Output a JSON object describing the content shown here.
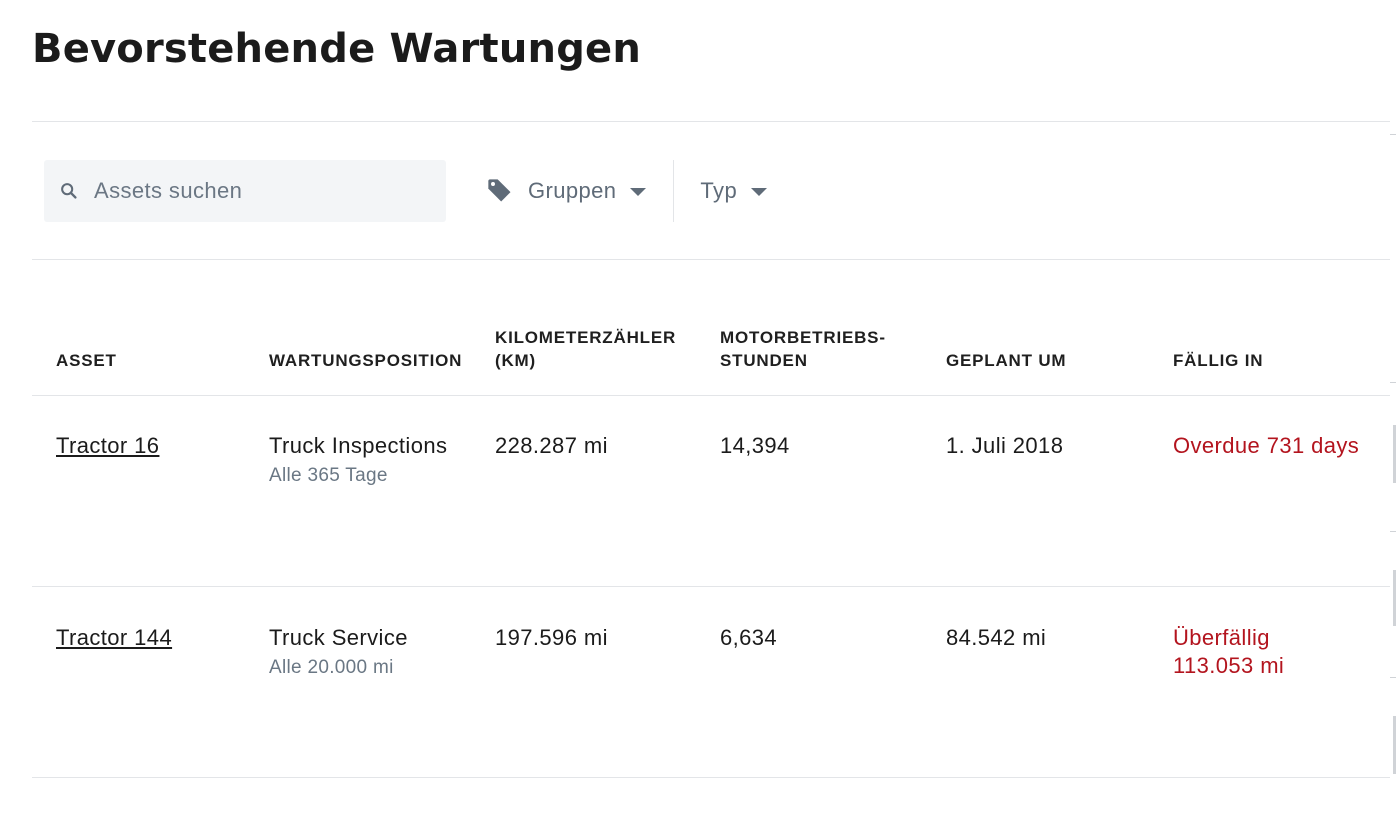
{
  "page": {
    "title": "Bevorstehende Wartungen"
  },
  "toolbar": {
    "search_placeholder": "Assets suchen",
    "groups_label": "Gruppen",
    "type_label": "Typ"
  },
  "table": {
    "columns": [
      {
        "key": "asset",
        "label": "ASSET"
      },
      {
        "key": "item",
        "label": "WARTUNGSPOSITION"
      },
      {
        "key": "odometer",
        "label": "KILOMETERZÄHLER (KM)"
      },
      {
        "key": "engine_hours",
        "label": "MOTORBETRIEBS- STUNDEN"
      },
      {
        "key": "scheduled",
        "label": "GEPLANT UM"
      },
      {
        "key": "due",
        "label": "FÄLLIG IN"
      }
    ],
    "rows": [
      {
        "asset": "Tractor 16",
        "item": "Truck Inspections",
        "interval": "Alle 365 Tage",
        "odometer": "228.287 mi",
        "engine_hours": "14,394",
        "scheduled": "1. Juli 2018",
        "due": "Overdue 731 days"
      },
      {
        "asset": "Tractor 144",
        "item": "Truck Service",
        "interval": "Alle 20.000 mi",
        "odometer": "197.596 mi",
        "engine_hours": "6,634",
        "scheduled": "84.542 mi",
        "due": "Überfällig 113.053 mi"
      }
    ]
  },
  "colors": {
    "overdue": "#b3141e",
    "muted_text": "#6a7784",
    "search_bg": "#f3f5f7",
    "divider": "#e3e5e8"
  },
  "icons": {
    "search": "search-icon",
    "groups": "tag-icon",
    "dropdown": "caret-down-icon"
  }
}
